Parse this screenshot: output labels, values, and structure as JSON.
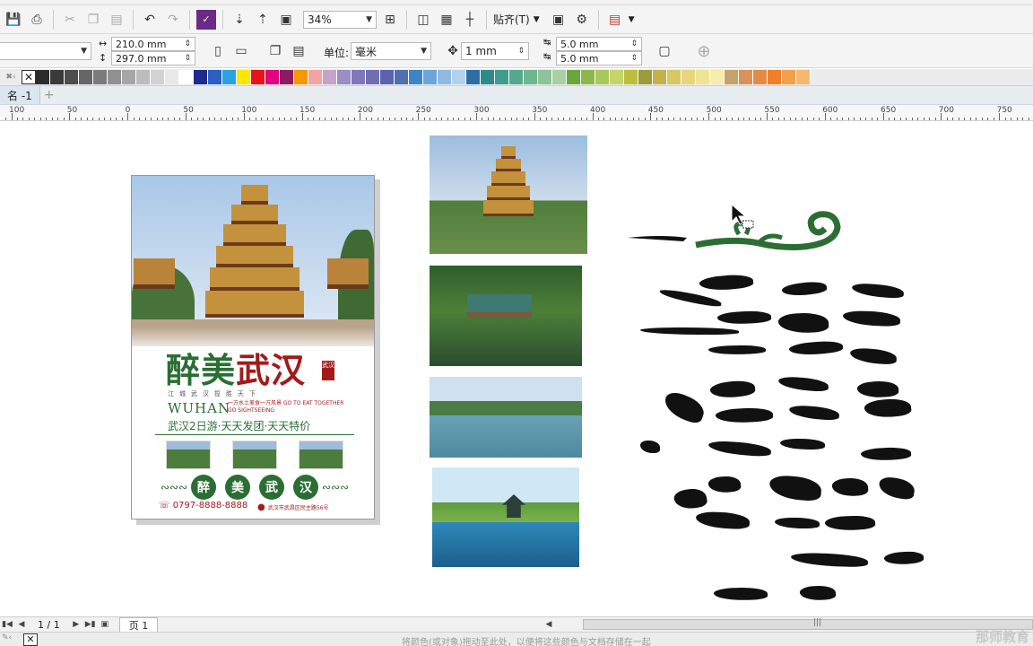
{
  "toolbar": {
    "zoom": "34%",
    "snap_label": "贴齐(T)"
  },
  "propbar": {
    "width": "210.0 mm",
    "height": "297.0 mm",
    "units_label": "单位:",
    "units_value": "毫米",
    "nudge": "1 mm",
    "dup_x": "5.0 mm",
    "dup_y": "5.0 mm"
  },
  "palette": {
    "colors": [
      "#2b2b2b",
      "#3a3a3a",
      "#4d4d4d",
      "#666",
      "#7b7b7b",
      "#909090",
      "#a6a6a6",
      "#bcbcbc",
      "#d2d2d2",
      "#e8e8e8",
      "#ffffff",
      "#1e2a8c",
      "#2a5fc4",
      "#29a3e0",
      "#ffe600",
      "#e8141a",
      "#e4007f",
      "#8b1c62",
      "#f39800",
      "#f5a2a2",
      "#c8a2c8",
      "#9b8ec4",
      "#7f78b8",
      "#6f6fb2",
      "#5a62ad",
      "#4f6fae",
      "#3f84c6",
      "#6aa6d8",
      "#8fbbe0",
      "#b3d1ea",
      "#2c6fa5",
      "#2d8a8a",
      "#3d9d8a",
      "#55a88c",
      "#6fb58f",
      "#8cc39a",
      "#aacfa6",
      "#6ba63a",
      "#8cb84a",
      "#a9c85a",
      "#c4d66a",
      "#bdbd40",
      "#9c9c3a",
      "#c6b04c",
      "#d9c765",
      "#e6d57d",
      "#f0e494",
      "#f6ecab",
      "#c8a06a",
      "#d9925a",
      "#e38a44",
      "#ee8028",
      "#f3a04c",
      "#f6b86e"
    ]
  },
  "doctab": {
    "name": "名 -1"
  },
  "ruler": {
    "labels": [
      "100",
      "50",
      "0",
      "50",
      "100",
      "150",
      "200",
      "250",
      "300",
      "350",
      "400",
      "450",
      "500",
      "550",
      "600",
      "650",
      "700",
      "750"
    ]
  },
  "poster": {
    "title_green": "醉美",
    "title_red": "武汉",
    "seal": "武汉",
    "sub_row": "江城武汉揽胜天下",
    "wuhan": "WUHAN",
    "wuhan_tag": "一方水土美食一方风景 GO TO EAT TOGETHER GO SIGHTSEEING",
    "tagline": "武汉2日游·天天发团·天天特价",
    "circles": [
      "醉",
      "美",
      "武",
      "汉"
    ],
    "phone": "0797-8888-8888",
    "address": "武汉市武昌区民主路56号"
  },
  "pagebar": {
    "page_count": "1 / 1",
    "page_tab": "页 1"
  },
  "statusbar": {
    "hint": "将颜色(或对象)拖动至此处，以便将这些颜色与文档存储在一起",
    "watermark": "那师教育"
  }
}
